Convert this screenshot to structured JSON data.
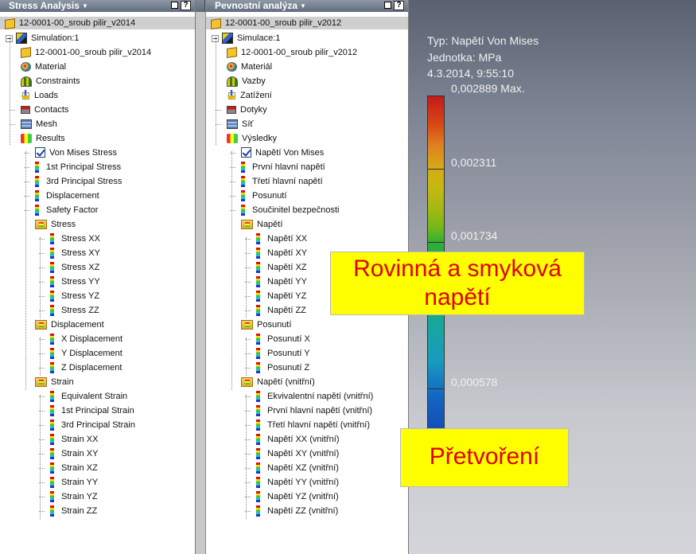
{
  "left_panel": {
    "title": "Stress Analysis",
    "help": "?",
    "tree": [
      {
        "label": "12-0001-00_sroub pilir_v2014",
        "icon": "part"
      },
      {
        "label": "Simulation:1",
        "icon": "simulation"
      },
      {
        "label": "12-0001-00_sroub pilir_v2014",
        "icon": "part"
      },
      {
        "label": "Material",
        "icon": "material"
      },
      {
        "label": "Constraints",
        "icon": "constraints"
      },
      {
        "label": "Loads",
        "icon": "loads"
      },
      {
        "label": "Contacts",
        "icon": "contacts"
      },
      {
        "label": "Mesh",
        "icon": "mesh"
      },
      {
        "label": "Results",
        "icon": "results"
      },
      {
        "label": "Von Mises Stress",
        "icon": "checked"
      },
      {
        "label": "1st Principal Stress",
        "icon": "result-bar"
      },
      {
        "label": "3rd Principal Stress",
        "icon": "result-bar"
      },
      {
        "label": "Displacement",
        "icon": "result-bar"
      },
      {
        "label": "Safety Factor",
        "icon": "result-bar"
      },
      {
        "label": "Stress",
        "icon": "folder"
      },
      {
        "label": "Stress XX",
        "icon": "result-bar"
      },
      {
        "label": "Stress XY",
        "icon": "result-bar"
      },
      {
        "label": "Stress XZ",
        "icon": "result-bar"
      },
      {
        "label": "Stress YY",
        "icon": "result-bar"
      },
      {
        "label": "Stress YZ",
        "icon": "result-bar"
      },
      {
        "label": "Stress ZZ",
        "icon": "result-bar"
      },
      {
        "label": "Displacement",
        "icon": "folder"
      },
      {
        "label": "X Displacement",
        "icon": "result-bar"
      },
      {
        "label": "Y Displacement",
        "icon": "result-bar"
      },
      {
        "label": "Z Displacement",
        "icon": "result-bar"
      },
      {
        "label": "Strain",
        "icon": "folder"
      },
      {
        "label": "Equivalent Strain",
        "icon": "result-bar"
      },
      {
        "label": "1st Principal Strain",
        "icon": "result-bar"
      },
      {
        "label": "3rd Principal Strain",
        "icon": "result-bar"
      },
      {
        "label": "Strain XX",
        "icon": "result-bar"
      },
      {
        "label": "Strain XY",
        "icon": "result-bar"
      },
      {
        "label": "Strain XZ",
        "icon": "result-bar"
      },
      {
        "label": "Strain YY",
        "icon": "result-bar"
      },
      {
        "label": "Strain YZ",
        "icon": "result-bar"
      },
      {
        "label": "Strain ZZ",
        "icon": "result-bar"
      }
    ]
  },
  "right_panel": {
    "title": "Pevnostní analýza",
    "help": "?",
    "tree": [
      {
        "label": "12-0001-00_sroub pilir_v2012",
        "icon": "part"
      },
      {
        "label": "Simulace:1",
        "icon": "simulation"
      },
      {
        "label": "12-0001-00_sroub pilir_v2012",
        "icon": "part"
      },
      {
        "label": "Materiál",
        "icon": "material"
      },
      {
        "label": "Vazby",
        "icon": "constraints"
      },
      {
        "label": "Zatížení",
        "icon": "loads"
      },
      {
        "label": "Dotyky",
        "icon": "contacts"
      },
      {
        "label": "Síť",
        "icon": "mesh"
      },
      {
        "label": "Výsledky",
        "icon": "results"
      },
      {
        "label": "Napětí Von Mises",
        "icon": "checked"
      },
      {
        "label": "První hlavní napětí",
        "icon": "result-bar"
      },
      {
        "label": "Třetí hlavní napětí",
        "icon": "result-bar"
      },
      {
        "label": "Posunutí",
        "icon": "result-bar"
      },
      {
        "label": "Součinitel bezpečnosti",
        "icon": "result-bar"
      },
      {
        "label": "Napětí",
        "icon": "folder"
      },
      {
        "label": "Napětí XX",
        "icon": "result-bar"
      },
      {
        "label": "Napětí XY",
        "icon": "result-bar"
      },
      {
        "label": "Napětí XZ",
        "icon": "result-bar"
      },
      {
        "label": "Napětí YY",
        "icon": "result-bar"
      },
      {
        "label": "Napětí YZ",
        "icon": "result-bar"
      },
      {
        "label": "Napětí ZZ",
        "icon": "result-bar"
      },
      {
        "label": "Posunutí",
        "icon": "folder"
      },
      {
        "label": "Posunutí X",
        "icon": "result-bar"
      },
      {
        "label": "Posunutí Y",
        "icon": "result-bar"
      },
      {
        "label": "Posunutí Z",
        "icon": "result-bar"
      },
      {
        "label": "Napětí (vnitřní)",
        "icon": "folder"
      },
      {
        "label": "Ekvivalentní napětí (vnitřní)",
        "icon": "result-bar"
      },
      {
        "label": "První hlavní napětí (vnitřní)",
        "icon": "result-bar"
      },
      {
        "label": "Třetí hlavní napětí (vnitřní)",
        "icon": "result-bar"
      },
      {
        "label": "Napětí XX (vnitřní)",
        "icon": "result-bar"
      },
      {
        "label": "Napětí XY (vnitřní)",
        "icon": "result-bar"
      },
      {
        "label": "Napětí XZ (vnitřní)",
        "icon": "result-bar"
      },
      {
        "label": "Napětí YY (vnitřní)",
        "icon": "result-bar"
      },
      {
        "label": "Napětí YZ (vnitřní)",
        "icon": "result-bar"
      },
      {
        "label": "Napětí ZZ (vnitřní)",
        "icon": "result-bar"
      }
    ]
  },
  "viewport": {
    "type_line": "Typ: Napětí Von Mises",
    "unit_line": "Jednotka: MPa",
    "date_line": "4.3.2014, 9:55:10",
    "legend_max": "0,002889 Max.",
    "legend_v2": "0,002311",
    "legend_v3": "0,001734",
    "legend_v4": "0,000578"
  },
  "callouts": {
    "c1_line1": "Rovinná a smyková",
    "c1_line2": "napětí",
    "c2": "Přetvoření"
  }
}
